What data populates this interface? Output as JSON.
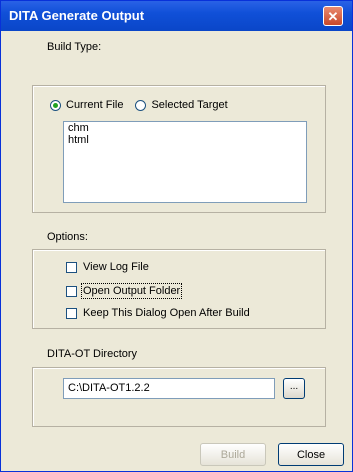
{
  "window": {
    "title": "DITA Generate Output",
    "close_glyph": "✕"
  },
  "build_type": {
    "label": "Build Type:",
    "radio_current": "Current File",
    "radio_selected": "Selected Target",
    "selected": "Current File",
    "targets": [
      "chm",
      "html"
    ]
  },
  "options": {
    "label": "Options:",
    "view_log": "View Log File",
    "open_output": "Open Output Folder",
    "keep_open": "Keep This Dialog Open After Build"
  },
  "ditaot": {
    "label": "DITA-OT Directory",
    "path": "C:\\DITA-OT1.2.2",
    "browse_label": "..."
  },
  "buttons": {
    "build": "Build",
    "close": "Close"
  }
}
